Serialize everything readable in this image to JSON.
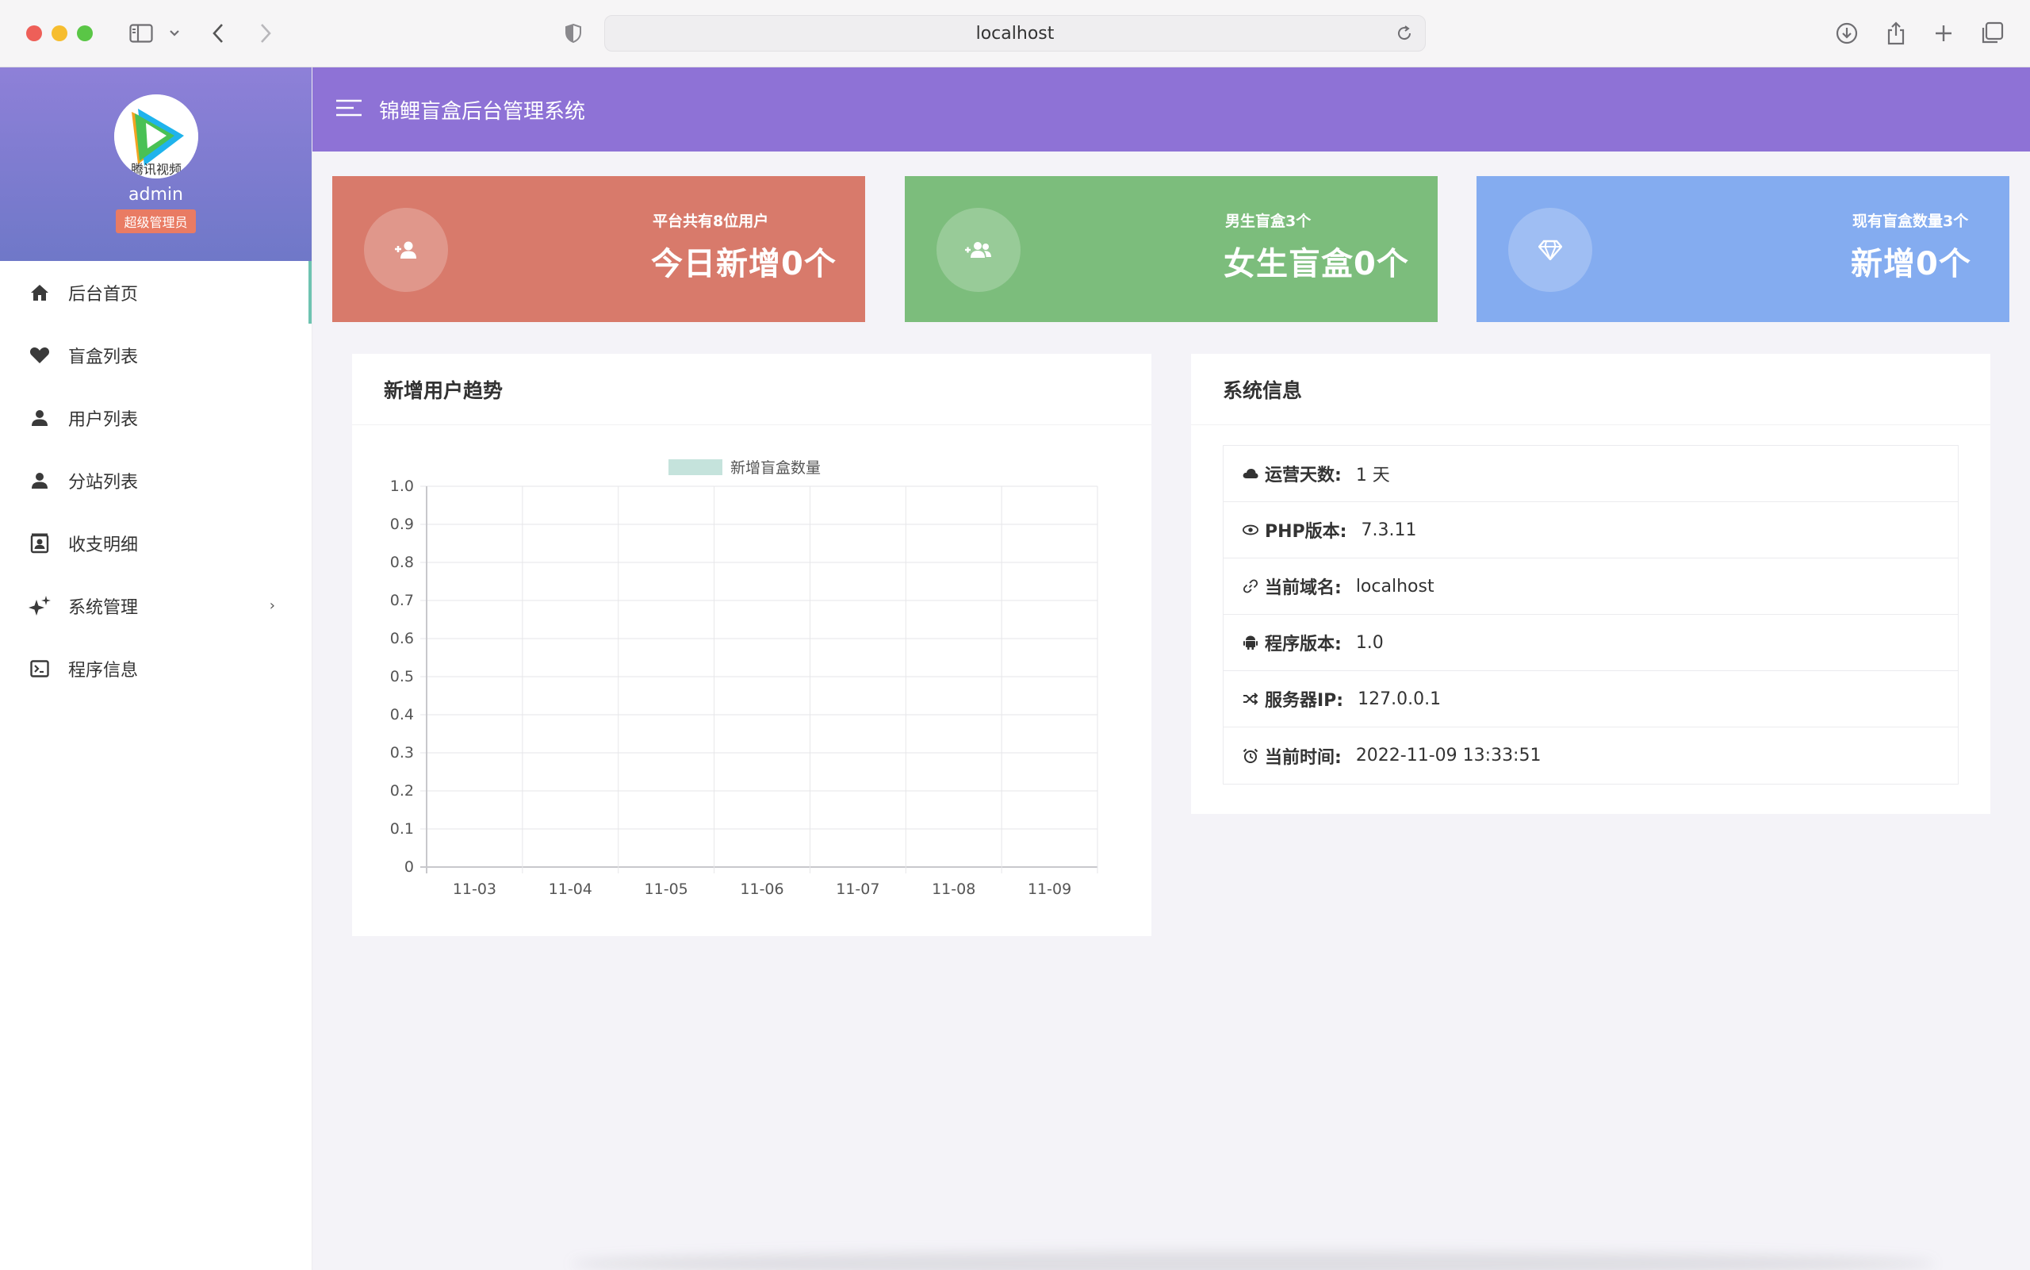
{
  "browser": {
    "url": "localhost"
  },
  "sidebar": {
    "admin_name": "admin",
    "role": "超级管理员",
    "avatar_caption": "腾讯视频",
    "items": [
      {
        "label": "后台首页",
        "icon": "home-icon"
      },
      {
        "label": "盲盒列表",
        "icon": "heart-icon"
      },
      {
        "label": "用户列表",
        "icon": "user-icon"
      },
      {
        "label": "分站列表",
        "icon": "user-icon"
      },
      {
        "label": "收支明细",
        "icon": "contact-book-icon"
      },
      {
        "label": "系统管理",
        "icon": "sparkles-icon",
        "arrow": "›"
      },
      {
        "label": "程序信息",
        "icon": "terminal-icon"
      }
    ]
  },
  "header": {
    "title": "锦鲤盲盒后台管理系统"
  },
  "cards": [
    {
      "small": "平台共有8位用户",
      "big": "今日新增0个",
      "color": "#d87a6b",
      "icon": "user-plus-icon"
    },
    {
      "small": "男生盲盒3个",
      "big": "女生盲盒0个",
      "color": "#7cbd7c",
      "icon": "users-plus-icon"
    },
    {
      "small": "现有盲盒数量3个",
      "big": "新增0个",
      "color": "#84acf0",
      "icon": "diamond-icon"
    }
  ],
  "chart_panel": {
    "title": "新增用户趋势"
  },
  "chart_data": {
    "type": "bar",
    "categories": [
      "11-03",
      "11-04",
      "11-05",
      "11-06",
      "11-07",
      "11-08",
      "11-09"
    ],
    "series": [
      {
        "name": "新增盲盒数量",
        "values": [
          0,
          0,
          0,
          0,
          0,
          0,
          0
        ],
        "color": "#c5e3dc"
      }
    ],
    "yticks": [
      "0",
      "0.1",
      "0.2",
      "0.3",
      "0.4",
      "0.5",
      "0.6",
      "0.7",
      "0.8",
      "0.9",
      "1.0"
    ],
    "ylim": [
      0,
      1
    ],
    "grid": true,
    "legend": "top"
  },
  "info_panel": {
    "title": "系统信息",
    "rows": [
      {
        "label": "运营天数:",
        "value": "1 天",
        "icon": "cloud-icon"
      },
      {
        "label": "PHP版本:",
        "value": "7.3.11",
        "icon": "eye-icon"
      },
      {
        "label": "当前域名:",
        "value": "localhost",
        "icon": "link-icon"
      },
      {
        "label": "程序版本:",
        "value": "1.0",
        "icon": "android-icon"
      },
      {
        "label": "服务器IP:",
        "value": "127.0.0.1",
        "icon": "shuffle-icon"
      },
      {
        "label": "当前时间:",
        "value": "2022-11-09 13:33:51",
        "icon": "alarm-icon"
      }
    ]
  }
}
